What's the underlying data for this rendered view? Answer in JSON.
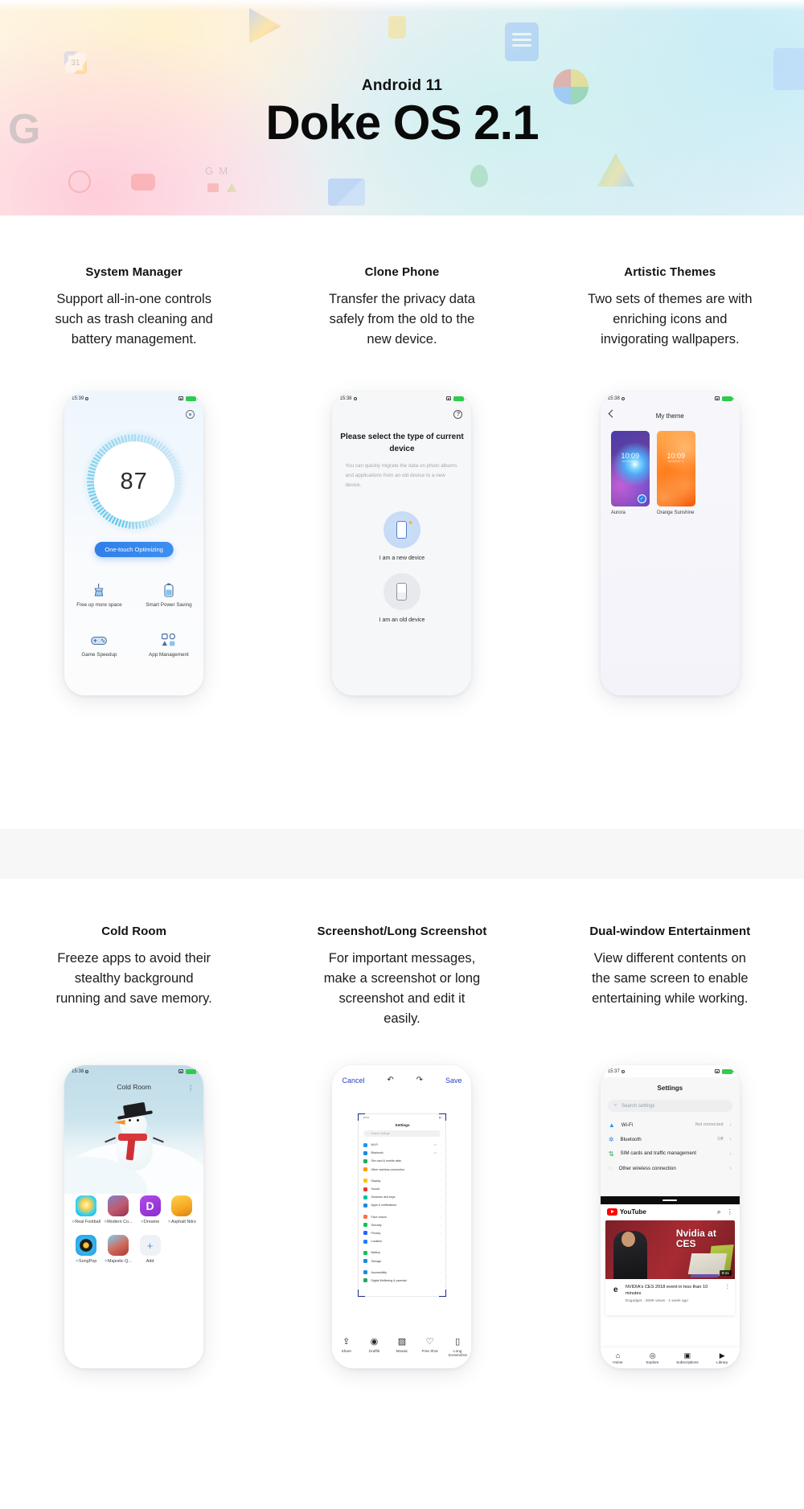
{
  "hero": {
    "subtitle": "Android 11",
    "title": "Doke OS 2.1",
    "icons": [
      "calendar-icon",
      "google-icon",
      "play-store-icon",
      "youtube-icon",
      "gmail-icon",
      "docs-icon",
      "photos-icon",
      "maps-icon",
      "drive-icon",
      "keep-icon",
      "duo-icon"
    ]
  },
  "features_row1": [
    {
      "title": "System Manager",
      "desc": "Support all-in-one controls such as trash cleaning and battery management."
    },
    {
      "title": "Clone Phone",
      "desc": "Transfer the privacy data safely from the old to the new device."
    },
    {
      "title": "Artistic Themes",
      "desc": "Two sets of themes are with enriching icons and invigorating wallpapers."
    }
  ],
  "features_row2": [
    {
      "title": "Cold Room",
      "desc": "Freeze apps to avoid their stealthy background running and save memory."
    },
    {
      "title": "Screenshot/Long Screenshot",
      "desc": "For important messages, make a screenshot or long screenshot and edit it easily."
    },
    {
      "title": "Dual-window Entertainment",
      "desc": "View different contents on the same screen to enable entertaining while working."
    }
  ],
  "phone_system_manager": {
    "status_time": "15:39",
    "score": "87",
    "optimize_button": "One-touch Optimizing",
    "tiles": [
      {
        "label": "Free up more space",
        "icon": "broom-icon"
      },
      {
        "label": "Smart Power Saving",
        "icon": "battery-icon"
      },
      {
        "label": "Game Speedup",
        "icon": "gamepad-icon"
      },
      {
        "label": "App Management",
        "icon": "apps-icon"
      }
    ]
  },
  "phone_clone": {
    "status_time": "15:38",
    "heading": "Please select the type of current device",
    "paragraph": "You can quickly migrate the data on photo albums and applications from an old device to a new device.",
    "options": [
      {
        "label": "I am a new device",
        "icon": "new-phone-icon"
      },
      {
        "label": "I am an old device",
        "icon": "old-phone-icon"
      }
    ],
    "help_icon": "help-icon"
  },
  "phone_themes": {
    "status_time": "15:38",
    "title": "My theme",
    "back_icon": "back-chevron-icon",
    "themes": [
      {
        "name": "Aurora",
        "clock": "10:09",
        "clock_sub": "MONDAY 4",
        "selected": true
      },
      {
        "name": "Orange Sunshine",
        "clock": "10:09",
        "clock_sub": "MONDAY 4",
        "selected": false
      }
    ]
  },
  "phone_cold_room": {
    "status_time": "15:38",
    "title": "Cold Room",
    "menu_icon": "more-vertical-icon",
    "apps": [
      {
        "label": "Real Football",
        "frozen": true
      },
      {
        "label": "Modern Co...",
        "frozen": true
      },
      {
        "label": "Dreame",
        "frozen": true
      },
      {
        "label": "Asphalt Nitro",
        "frozen": true
      },
      {
        "label": "SongPop",
        "frozen": true
      },
      {
        "label": "Majestic Q...",
        "frozen": true
      },
      {
        "label": "Add",
        "frozen": false
      }
    ]
  },
  "phone_screenshot": {
    "cancel_label": "Cancel",
    "save_label": "Save",
    "undo_icon": "undo-icon",
    "redo_icon": "redo-icon",
    "preview": {
      "status_time": "15:54",
      "title": "Settings",
      "search_placeholder": "Search settings",
      "items": [
        {
          "label": "Wi-Fi",
          "value": "Off",
          "color": "#2196f3"
        },
        {
          "label": "Bluetooth",
          "value": "Off",
          "color": "#1e88e5"
        },
        {
          "label": "Sim card & mobile data",
          "value": "",
          "color": "#26a65b"
        },
        {
          "label": "Other wireless connection",
          "value": "",
          "color": "#ff9800"
        },
        {
          "label": "Display",
          "value": "",
          "color": "#ffc107"
        },
        {
          "label": "Sound",
          "value": "",
          "color": "#e53935"
        },
        {
          "label": "Gestures and keys",
          "value": "",
          "color": "#00bfa5"
        },
        {
          "label": "Apps & notifications",
          "value": "",
          "color": "#1e88e5"
        },
        {
          "label": "Face unlock",
          "value": "",
          "color": "#ff7043"
        },
        {
          "label": "Security",
          "value": "",
          "color": "#00c853"
        },
        {
          "label": "Privacy",
          "value": "",
          "color": "#2962ff"
        },
        {
          "label": "Location",
          "value": "",
          "color": "#2979ff"
        },
        {
          "label": "Battery",
          "value": "",
          "color": "#00c853"
        },
        {
          "label": "Storage",
          "value": "",
          "color": "#1e88e5"
        },
        {
          "label": "Accessibility",
          "value": "",
          "color": "#1e88e5"
        },
        {
          "label": "Digital Wellbeing & parental",
          "value": "",
          "color": "#26a65b"
        }
      ]
    },
    "tools": [
      {
        "label": "Share",
        "icon": "share-icon"
      },
      {
        "label": "Graffiti",
        "icon": "graffiti-icon"
      },
      {
        "label": "Mosaic",
        "icon": "mosaic-icon"
      },
      {
        "label": "Free Shot",
        "icon": "heart-icon"
      },
      {
        "label": "Long Screenshot",
        "icon": "long-screenshot-icon"
      }
    ]
  },
  "phone_dual_window": {
    "status_time": "15:37",
    "settings_title": "Settings",
    "search_placeholder": "Search settings",
    "settings_items": [
      {
        "label": "Wi-Fi",
        "value": "Not connected",
        "icon": "wifi-icon"
      },
      {
        "label": "Bluetooth",
        "value": "Off",
        "icon": "bluetooth-icon"
      },
      {
        "label": "SIM cards and traffic management",
        "value": "",
        "icon": "sim-icon"
      },
      {
        "label": "Other wireless connection",
        "value": "",
        "icon": "wireless-icon"
      }
    ],
    "youtube": {
      "brand": "YouTube",
      "search_icon": "search-icon",
      "menu_icon": "more-vertical-icon",
      "video_overlay": "Nvidia at CES",
      "duration": "9:21",
      "video_title": "NVIDIA's CES 2018 event in less than 10 minutes",
      "video_meta": "Engadget · 280K views · 1 week ago",
      "channel_initial": "e",
      "nav": [
        {
          "label": "Home",
          "icon": "home-icon"
        },
        {
          "label": "Explore",
          "icon": "compass-icon"
        },
        {
          "label": "Subscriptions",
          "icon": "subscriptions-icon"
        },
        {
          "label": "Library",
          "icon": "library-icon"
        }
      ]
    }
  }
}
